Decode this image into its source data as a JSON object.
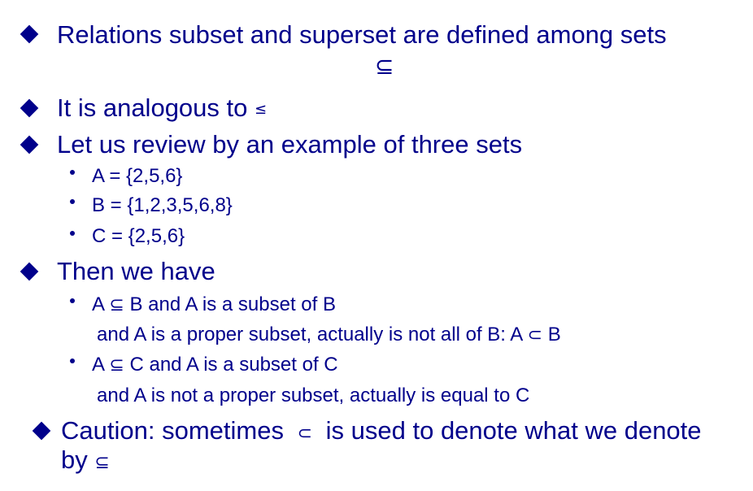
{
  "bullets": {
    "b1": {
      "text": "Relations subset and superset are defined among sets",
      "symbol": "⊆"
    },
    "b2": {
      "text": "It is analogous to",
      "symbol": "≤"
    },
    "b3": {
      "text": "Let us review by an example of three sets",
      "sub": [
        "A = {2,5,6}",
        "B = {1,2,3,5,6,8}",
        "C =  {2,5,6}"
      ]
    },
    "b4": {
      "text": "Then we have",
      "sub1": {
        "a": "A",
        "subseteq": "⊆",
        "rest": "B  and A is a subset of B",
        "cont": "and A is a proper subset, actually is not all of B: A",
        "subset": "⊂",
        "end": "B"
      },
      "sub2": {
        "a": "A",
        "subseteq": "⊆",
        "rest": "C and A is a subset of C",
        "cont": "and A is not a proper subset, actually is equal to C"
      }
    },
    "b5": {
      "pre": "Caution: sometimes",
      "subset": "⊂",
      "post": "is used to denote what we denote",
      "line2": "by",
      "subseteq": "⊆"
    }
  }
}
